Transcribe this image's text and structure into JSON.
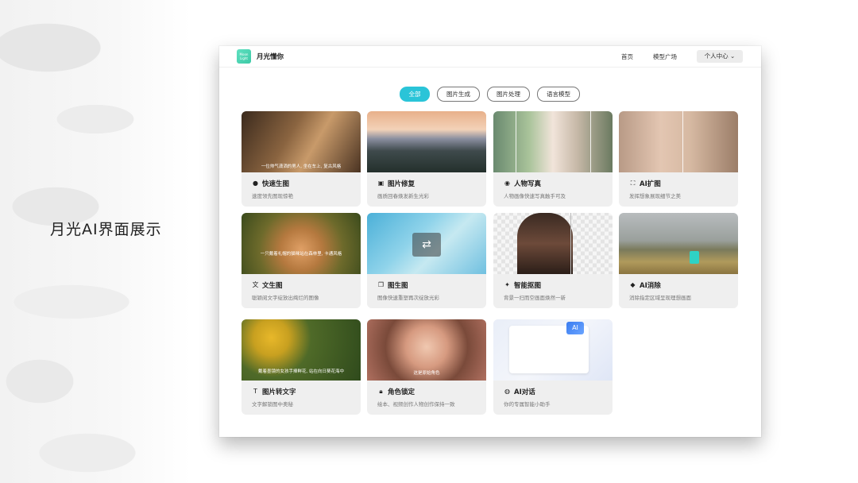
{
  "slide": {
    "title": "月光AI界面展示"
  },
  "app": {
    "logo_text": "Moon Light",
    "name": "月光懂你",
    "nav": {
      "home": "首页",
      "models": "模型广场",
      "user_menu": "个人中心"
    }
  },
  "filters": [
    {
      "label": "全部",
      "active": true
    },
    {
      "label": "图片生成",
      "active": false
    },
    {
      "label": "图片处理",
      "active": false
    },
    {
      "label": "语言模型",
      "active": false
    }
  ],
  "cards": [
    {
      "title": "快速生图",
      "desc": "速度领先图现惊艳",
      "icon": "rocket-icon",
      "caption": "一位帅气潇洒的男人, 坐在车上, 复古风格"
    },
    {
      "title": "图片修复",
      "desc": "画质回春焕发新生光彩",
      "icon": "hd-icon",
      "caption": ""
    },
    {
      "title": "人物写真",
      "desc": "人物画像快速写真触手可及",
      "icon": "camera-icon",
      "caption": ""
    },
    {
      "title": "AI扩图",
      "desc": "发挥想象展现细节之美",
      "icon": "expand-icon",
      "caption": ""
    },
    {
      "title": "文生图",
      "desc": "聪颖阅文字绽放出绚烂的图像",
      "icon": "translate-icon",
      "caption": "一只戴着礼帽的猫咪站在森林里, 卡通风格"
    },
    {
      "title": "图生图",
      "desc": "图像快速重塑再次绽放光彩",
      "icon": "images-icon",
      "caption": ""
    },
    {
      "title": "智能抠图",
      "desc": "背景一扫而空画面焕然一新",
      "icon": "magic-wand-icon",
      "caption": ""
    },
    {
      "title": "AI消除",
      "desc": "消除指定区域呈现理想画面",
      "icon": "eraser-icon",
      "caption": ""
    },
    {
      "title": "图片转文字",
      "desc": "文字解锁图中奥秘",
      "icon": "text-box-icon",
      "caption": "戴着墨镜的女孩手捧鲜花, 站在向日葵花海中"
    },
    {
      "title": "角色锁定",
      "desc": "绘本、视频创作人物创作保持一致",
      "icon": "lock-icon",
      "caption": "这是原始角色"
    },
    {
      "title": "AI对话",
      "desc": "你的专属智能小助手",
      "icon": "globe-icon",
      "caption": ""
    }
  ],
  "colors": {
    "accent": "#2ac4d8",
    "brand": "#3cc9a6"
  }
}
